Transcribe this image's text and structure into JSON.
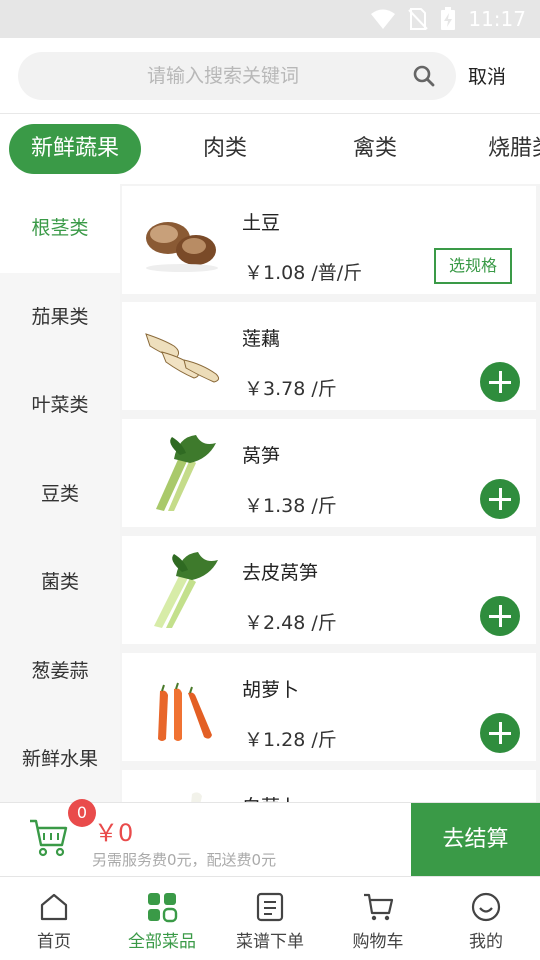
{
  "status_bar": {
    "time": "11:17"
  },
  "search": {
    "placeholder": "请输入搜索关键词",
    "value": "",
    "cancel_label": "取消"
  },
  "categories": [
    {
      "label": "新鲜蔬果",
      "active": true
    },
    {
      "label": "肉类",
      "active": false
    },
    {
      "label": "禽类",
      "active": false
    },
    {
      "label": "烧腊类",
      "active": false
    }
  ],
  "sidebar": {
    "items": [
      {
        "label": "根茎类",
        "active": true
      },
      {
        "label": "茄果类",
        "active": false
      },
      {
        "label": "叶菜类",
        "active": false
      },
      {
        "label": "豆类",
        "active": false
      },
      {
        "label": "菌类",
        "active": false
      },
      {
        "label": "葱姜蒜",
        "active": false
      },
      {
        "label": "新鲜水果",
        "active": false
      }
    ]
  },
  "products": [
    {
      "name": "土豆",
      "price": "￥1.08 /普/斤",
      "action": "选规格",
      "image": "potato-image"
    },
    {
      "name": "莲藕",
      "price": "￥3.78 /斤",
      "action": "add",
      "image": "lotus-root-image"
    },
    {
      "name": "莴笋",
      "price": "￥1.38 /斤",
      "action": "add",
      "image": "celtuce-image"
    },
    {
      "name": "去皮莴笋",
      "price": "￥2.48 /斤",
      "action": "add",
      "image": "peeled-celtuce-image"
    },
    {
      "name": "胡萝卜",
      "price": "￥1.28 /斤",
      "action": "add",
      "image": "carrot-image"
    },
    {
      "name": "白萝卜",
      "price": "",
      "action": "add",
      "image": "radish-image"
    }
  ],
  "cart": {
    "count": "0",
    "total": "￥0",
    "fee_note": "另需服务费0元，配送费0元",
    "checkout_label": "去结算"
  },
  "bottom_nav": [
    {
      "label": "首页",
      "icon": "home-icon",
      "active": false
    },
    {
      "label": "全部菜品",
      "icon": "grid-icon",
      "active": true
    },
    {
      "label": "菜谱下单",
      "icon": "recipe-icon",
      "active": false
    },
    {
      "label": "购物车",
      "icon": "cart-icon",
      "active": false
    },
    {
      "label": "我的",
      "icon": "profile-icon",
      "active": false
    }
  ],
  "colors": {
    "accent": "#3a9a47",
    "badge": "#e94b4b",
    "status_bar": "#e6e6e6"
  }
}
